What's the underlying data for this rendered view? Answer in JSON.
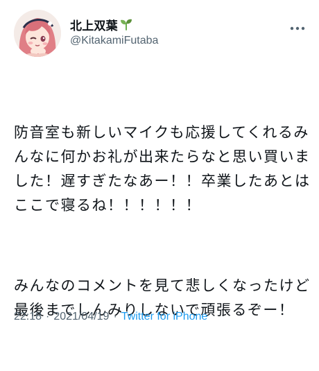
{
  "author": {
    "display_name": "北上双葉",
    "handle": "@KitakamiFutaba",
    "name_emoji": "seedling-icon",
    "avatar_icon": "anime-girl-avatar"
  },
  "tweet": {
    "paragraphs": [
      "防音室も新しいマイクも応援してくれるみんなに何かお礼が出来たらなと思い買いました！遅すぎたなあー！！卒業したあとはここで寝るね！！！！！！",
      "みんなのコメントを見て悲しくなったけど最後までしんみりしないで頑張るぞー！"
    ],
    "time": "22:18",
    "date": "2021/04/19",
    "separator": "·",
    "source": "Twitter for iPhone"
  },
  "colors": {
    "text": "#0f1419",
    "secondary": "#536471",
    "link": "#1d9bf0"
  },
  "icons": {
    "more": "more-horizontal-icon"
  }
}
